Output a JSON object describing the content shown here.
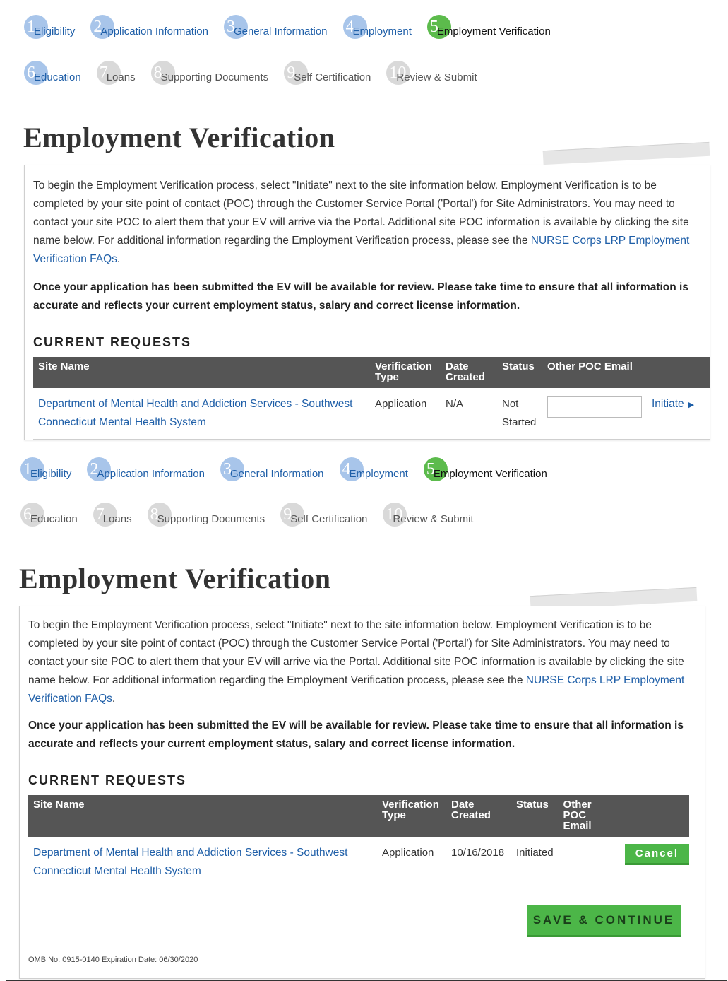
{
  "steps": [
    {
      "num": "1",
      "label": "Eligibility",
      "state": "done"
    },
    {
      "num": "2",
      "label": "Application Information",
      "state": "done"
    },
    {
      "num": "3",
      "label": "General Information",
      "state": "done"
    },
    {
      "num": "4",
      "label": "Employment",
      "state": "done"
    },
    {
      "num": "5",
      "label": "Employment Verification",
      "state": "active"
    },
    {
      "num": "6",
      "label": "Education",
      "state": "done"
    },
    {
      "num": "7",
      "label": "Loans",
      "state": "todo"
    },
    {
      "num": "8",
      "label": "Supporting Documents",
      "state": "todo"
    },
    {
      "num": "9",
      "label": "Self Certification",
      "state": "todo"
    },
    {
      "num": "10",
      "label": "Review & Submit",
      "state": "todo"
    }
  ],
  "page_title": "Employment Verification",
  "intro": {
    "text": "To begin the Employment Verification process, select \"Initiate\" next to the site information below. Employment Verification is to be completed by your site point of contact (POC) through the Customer Service Portal ('Portal') for Site Administrators. You may need to contact your site POC to alert them that your EV will arrive via the Portal. Additional site POC information is available by clicking the site name below. For additional information regarding the Employment Verification process, please see the ",
    "link": "NURSE Corps LRP Employment Verification FAQs",
    "end": "."
  },
  "notice": "Once your application has been submitted the EV will be available for review. Please take time to ensure that all information is accurate and reflects your current employment status, salary and correct license information.",
  "current_requests_title": "CURRENT REQUESTS",
  "table_headers": {
    "site_name": "Site Name",
    "verification_type": "Verification Type",
    "date_created": "Date Created",
    "status": "Status",
    "other_poc_email": "Other POC Email"
  },
  "before": {
    "site": "Department of Mental Health and Addiction Services - Southwest Connecticut Mental Health System",
    "verification_type": "Application",
    "date_created": "N/A",
    "status": "Not Started",
    "poc_email_value": "",
    "action_label": "Initiate"
  },
  "after": {
    "site": "Department of Mental Health and Addiction Services - Southwest Connecticut Mental Health System",
    "verification_type": "Application",
    "date_created": "10/16/2018",
    "status": "Initiated",
    "action_label": "Cancel"
  },
  "save_label": "SAVE & CONTINUE",
  "omb_text": "OMB No. 0915-0140 Expiration Date: 06/30/2020",
  "colors": {
    "link": "#1f5fa8",
    "active_step": "#5cbb4c",
    "done_step": "#a8c5ea",
    "todo_step": "#d9d9d9",
    "button": "#4cb648",
    "table_header": "#555555"
  }
}
